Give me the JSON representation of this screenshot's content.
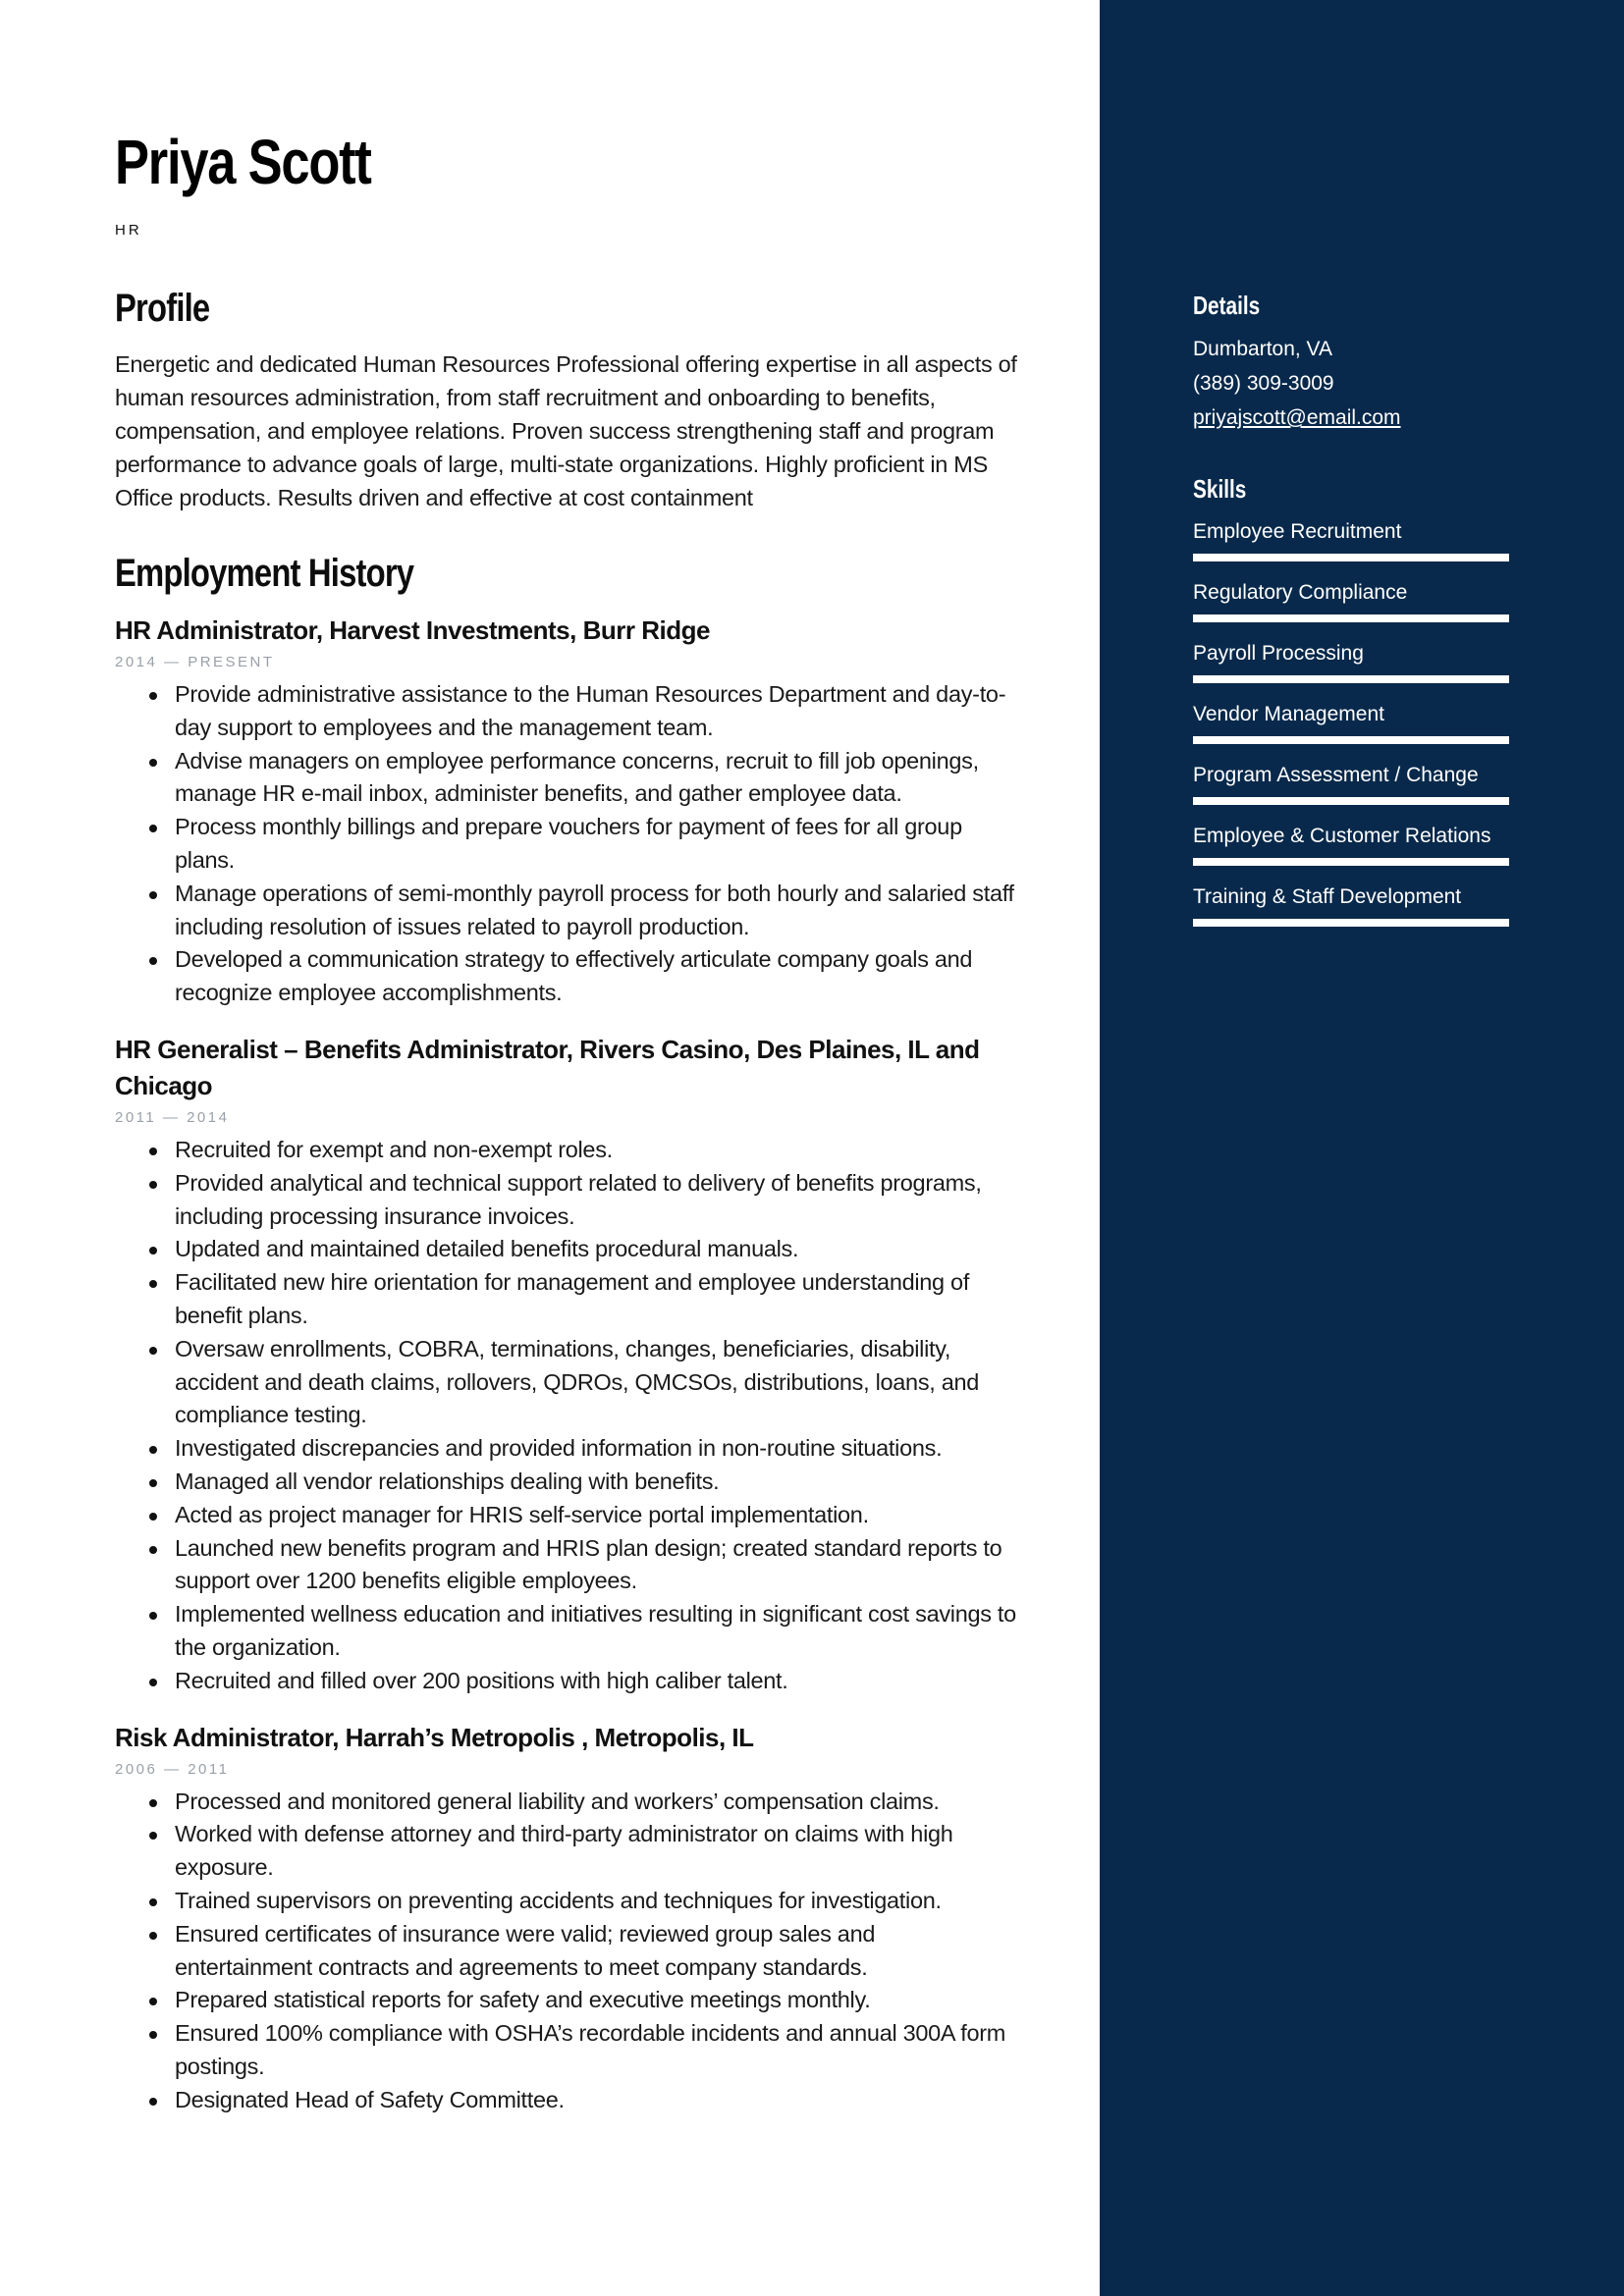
{
  "header": {
    "name": "Priya Scott",
    "job_title": "HR"
  },
  "profile": {
    "heading": "Profile",
    "text": "Energetic and dedicated Human Resources Professional offering expertise in all aspects of human resources administration, from staff recruitment and onboarding to benefits, compensation, and employee relations. Proven success strengthening staff and program performance to advance goals of large, multi-state organizations. Highly proficient in MS Office products. Results driven and effective at cost containment"
  },
  "employment": {
    "heading": "Employment History",
    "jobs": [
      {
        "title": "HR Administrator, Harvest Investments,  Burr Ridge",
        "dates": "2014 — PRESENT",
        "bullets": [
          "Provide administrative assistance to the Human Resources Department and day-to-day support to employees and the management team.",
          "Advise managers on employee performance concerns, recruit to fill job openings, manage HR e-mail inbox, administer benefits, and gather employee data.",
          "Process monthly billings and prepare vouchers for payment of fees for all group plans.",
          "Manage operations of semi-monthly payroll process for both hourly and salaried staff including resolution of issues related to payroll production.",
          "Developed a communication strategy to effectively articulate company goals and recognize employee accomplishments."
        ]
      },
      {
        "title": "HR Generalist – Benefits Administrator, Rivers Casino, Des Plaines, IL and Chicago",
        "dates": "2011 — 2014",
        "bullets": [
          "Recruited for exempt and non-exempt roles.",
          "Provided analytical and technical support related to delivery of benefits programs, including processing insurance invoices.",
          "Updated and maintained detailed benefits procedural manuals.",
          "Facilitated new hire orientation for management and employee understanding of benefit plans.",
          "Oversaw enrollments, COBRA, terminations, changes, beneficiaries, disability, accident and death claims, rollovers, QDROs, QMCSOs, distributions, loans, and compliance testing.",
          "Investigated discrepancies and provided information in non-routine situations.",
          "Managed all vendor relationships dealing with benefits.",
          "Acted as project manager for HRIS self-service portal implementation.",
          "Launched new benefits program and HRIS plan design; created standard reports to support over 1200 benefits eligible employees.",
          "Implemented wellness education and initiatives resulting in significant cost savings to the organization.",
          "Recruited and filled over 200 positions with high caliber talent."
        ]
      },
      {
        "title": "Risk Administrator, Harrah’s Metropolis , Metropolis, IL",
        "dates": "2006 — 2011",
        "bullets": [
          "Processed and monitored general liability and workers’ compensation claims.",
          "Worked with defense attorney and third-party administrator on claims with high exposure.",
          "Trained supervisors on preventing accidents and techniques for investigation.",
          "Ensured certificates of insurance were valid; reviewed group sales and entertainment contracts and agreements to meet company standards.",
          "Prepared statistical reports for safety and executive meetings monthly.",
          "Ensured 100% compliance with OSHA’s recordable incidents and annual 300A form postings.",
          "Designated Head of Safety Committee."
        ]
      }
    ]
  },
  "sidebar": {
    "background_color": "#08294b",
    "details": {
      "heading": "Details",
      "location": "Dumbarton, VA",
      "phone": "(389) 309-3009",
      "email": "priyajscott@email.com"
    },
    "skills": {
      "heading": "Skills",
      "items": [
        {
          "name": "Employee Recruitment",
          "level": 1.0
        },
        {
          "name": "Regulatory Compliance",
          "level": 1.0
        },
        {
          "name": "Payroll Processing",
          "level": 1.0
        },
        {
          "name": "Vendor Management",
          "level": 1.0
        },
        {
          "name": "Program Assessment / Change",
          "level": 1.0
        },
        {
          "name": "Employee & Customer Relations",
          "level": 1.0
        },
        {
          "name": "Training & Staff Development",
          "level": 1.0
        }
      ]
    }
  }
}
